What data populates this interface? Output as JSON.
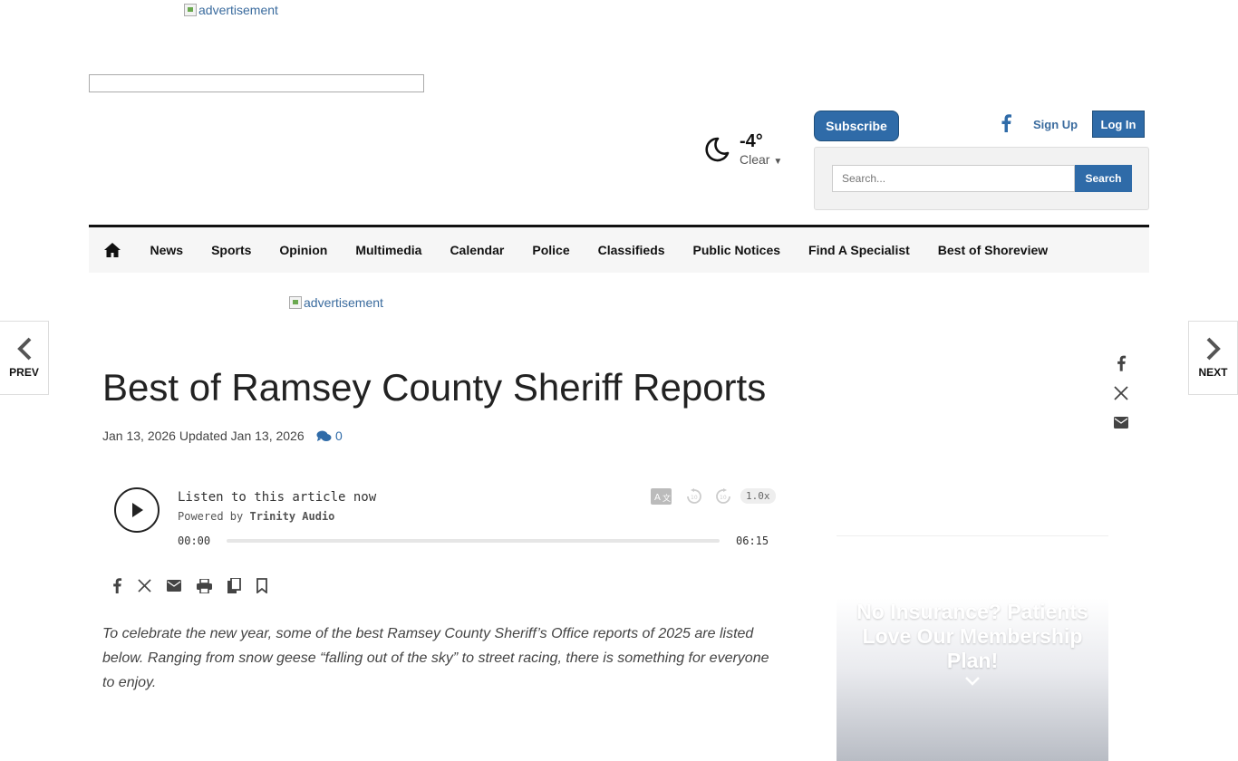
{
  "ads": {
    "top_alt": "advertisement",
    "mid_alt": "advertisement"
  },
  "weather": {
    "temp": "-4°",
    "condition": "Clear"
  },
  "header": {
    "subscribe": "Subscribe",
    "signup": "Sign Up",
    "login": "Log In"
  },
  "search": {
    "placeholder": "Search...",
    "button": "Search"
  },
  "nav": {
    "items": [
      "News",
      "Sports",
      "Opinion",
      "Multimedia",
      "Calendar",
      "Police",
      "Classifieds",
      "Public Notices",
      "Find A Specialist",
      "Best of Shoreview"
    ]
  },
  "pager": {
    "prev": "PREV",
    "next": "NEXT"
  },
  "article": {
    "title": "Best of Ramsey County Sheriff Reports",
    "date": "Jan 13, 2026 Updated Jan 13, 2026",
    "comments": "0",
    "lead": "To celebrate the new year, some of the best Ramsey County Sheriff’s Office reports of 2025 are listed below. Ranging from snow geese “falling out of the sky” to street racing, there is something for everyone to enjoy."
  },
  "player": {
    "listen": "Listen to this article now",
    "powered_prefix": "Powered by",
    "powered_brand": "Trinity Audio",
    "current": "00:00",
    "duration": "06:15",
    "speed": "1.0x",
    "progress": 0
  },
  "side_ad": {
    "text": "No Insurance? Patients Love Our Membership Plan!"
  }
}
